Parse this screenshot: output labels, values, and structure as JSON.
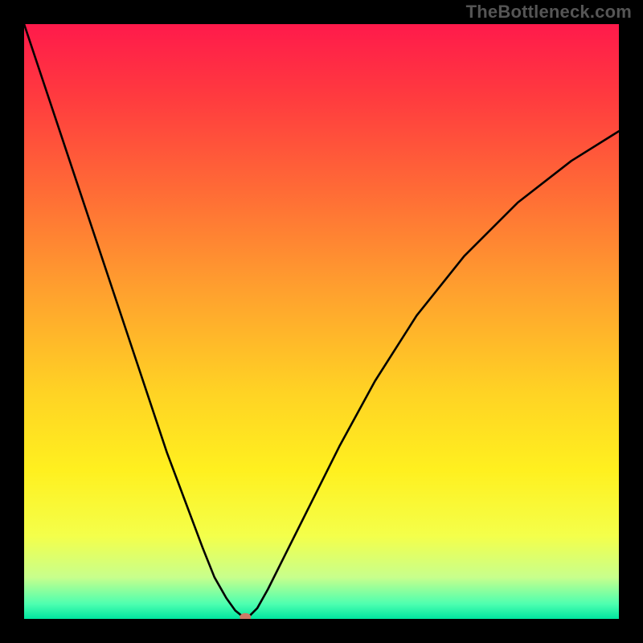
{
  "watermark": "TheBottleneck.com",
  "chart_data": {
    "type": "line",
    "title": "",
    "xlabel": "",
    "ylabel": "",
    "xlim": [
      0,
      100
    ],
    "ylim": [
      0,
      100
    ],
    "grid": false,
    "legend": false,
    "background_gradient": {
      "stops": [
        {
          "pos": 0.0,
          "color": "#ff1a4b"
        },
        {
          "pos": 0.12,
          "color": "#ff3a3f"
        },
        {
          "pos": 0.28,
          "color": "#ff6b36"
        },
        {
          "pos": 0.45,
          "color": "#ffa12e"
        },
        {
          "pos": 0.62,
          "color": "#ffd324"
        },
        {
          "pos": 0.75,
          "color": "#fff01f"
        },
        {
          "pos": 0.86,
          "color": "#f4ff4a"
        },
        {
          "pos": 0.93,
          "color": "#c8ff8c"
        },
        {
          "pos": 0.975,
          "color": "#4dffb0"
        },
        {
          "pos": 1.0,
          "color": "#00e6a0"
        }
      ]
    },
    "series": [
      {
        "name": "bottleneck-curve",
        "x": [
          0,
          3,
          6,
          9,
          12,
          15,
          18,
          21,
          24,
          27,
          30,
          32,
          34,
          35.5,
          36.5,
          37.2,
          38,
          39.2,
          41,
          44,
          48,
          53,
          59,
          66,
          74,
          83,
          92,
          100
        ],
        "y": [
          100,
          91,
          82,
          73,
          64,
          55,
          46,
          37,
          28,
          20,
          12,
          7,
          3.5,
          1.4,
          0.6,
          0.3,
          0.6,
          1.8,
          5,
          11,
          19,
          29,
          40,
          51,
          61,
          70,
          77,
          82
        ]
      }
    ],
    "marker": {
      "name": "optimal-point",
      "x": 37.2,
      "y": 0.3,
      "color": "#cc7a66"
    }
  }
}
